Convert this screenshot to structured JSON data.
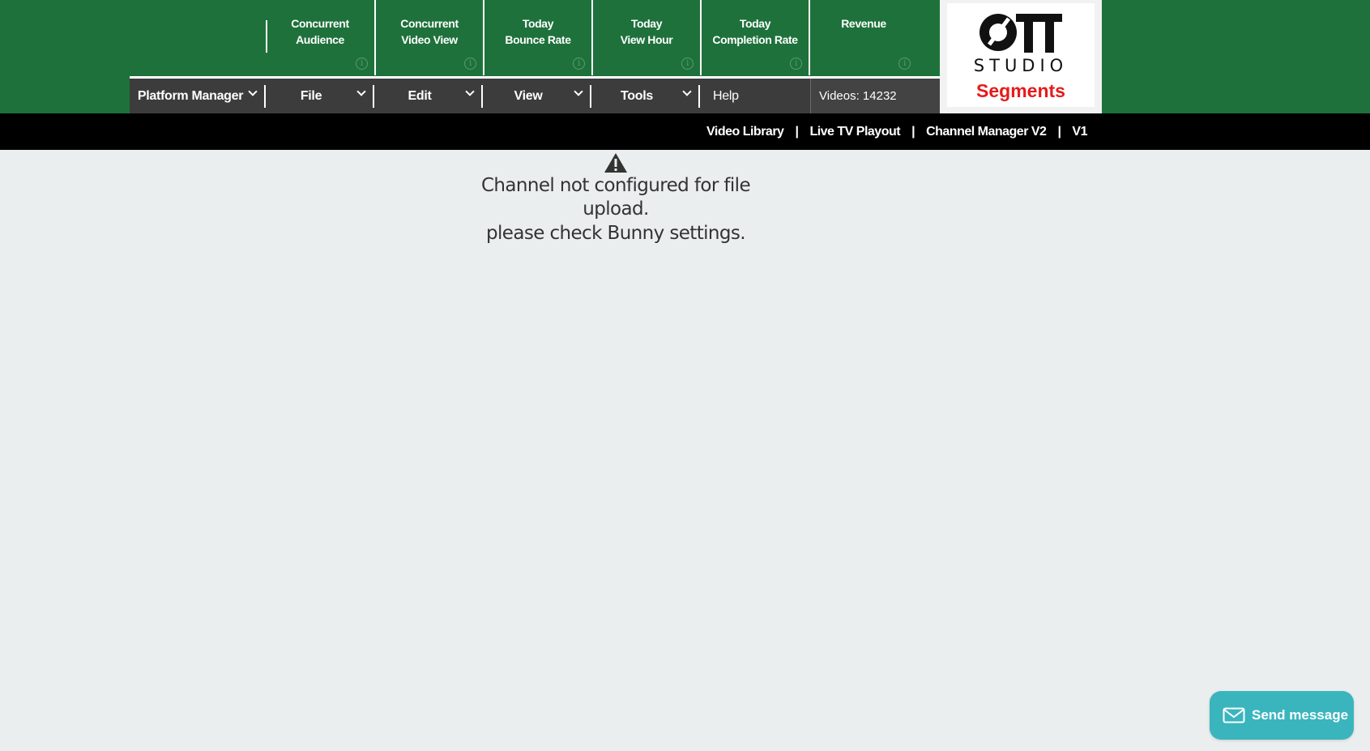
{
  "metrics": [
    {
      "line1": "Concurrent",
      "line2": "Audience"
    },
    {
      "line1": "Concurrent",
      "line2": "Video View"
    },
    {
      "line1": "Today",
      "line2": "Bounce Rate"
    },
    {
      "line1": "Today",
      "line2": "View Hour"
    },
    {
      "line1": "Today",
      "line2": "Completion Rate"
    },
    {
      "line1": "Revenue",
      "line2": ""
    }
  ],
  "menu": {
    "platform_manager": "Platform Manager",
    "file": "File",
    "edit": "Edit",
    "view": "View",
    "tools": "Tools",
    "help": "Help",
    "videos_count": "Videos: 14232"
  },
  "logo": {
    "ott": "OTT",
    "studio": "STUDIO",
    "segments": "Segments"
  },
  "nav": {
    "video_library": "Video Library",
    "live_tv_playout": "Live TV Playout",
    "channel_manager_v2": "Channel Manager V2",
    "v1": "V1",
    "separator": "|"
  },
  "warning": {
    "line1": "Channel not configured for file upload.",
    "line2": "please check Bunny settings."
  },
  "chat": {
    "send_label": "Send message"
  },
  "colors": {
    "header_green": "#1e713b",
    "menubar_dark": "#3c3c3c",
    "nav_black": "#000000",
    "page_bg": "#ebeeee",
    "segments_red": "#e51b1b",
    "chat_teal": "#3ab5be"
  },
  "icons": {
    "metric_info": "info-icon",
    "menu_dropdown": "chevron-down-icon",
    "warning": "warning-triangle-icon",
    "chat": "envelope-icon"
  }
}
